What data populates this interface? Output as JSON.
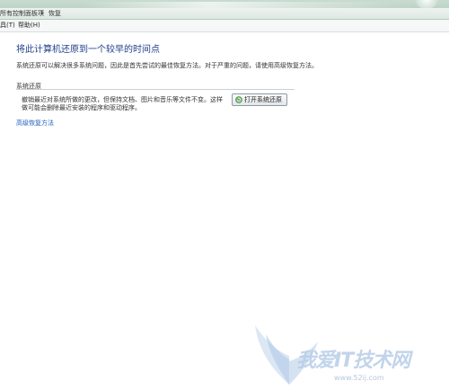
{
  "breadcrumb": {
    "items": [
      "所有控制面板项",
      "恢复"
    ]
  },
  "menu": {
    "items": [
      "具(T)",
      "帮助(H)"
    ]
  },
  "content": {
    "heading": "将此计算机还原到一个较早的时间点",
    "description": "系统还原可以解决很多系统问题，因此是首先尝试的最佳恢复方法。对于严重的问题，请使用高级恢复方法。",
    "section_label": "系统还原",
    "section_text": "撤销最近对系统所做的更改，但保持文档、图片和音乐等文件不变。这样做可能会删除最近安装的程序和驱动程序。",
    "button_label": "打开系统还原",
    "link_label": "高级恢复方法"
  },
  "watermark": {
    "text": "我爱IT技术网",
    "url": "www.52ij.com"
  },
  "colors": {
    "heading": "#1e3f8a",
    "link": "#1d5fbf"
  }
}
